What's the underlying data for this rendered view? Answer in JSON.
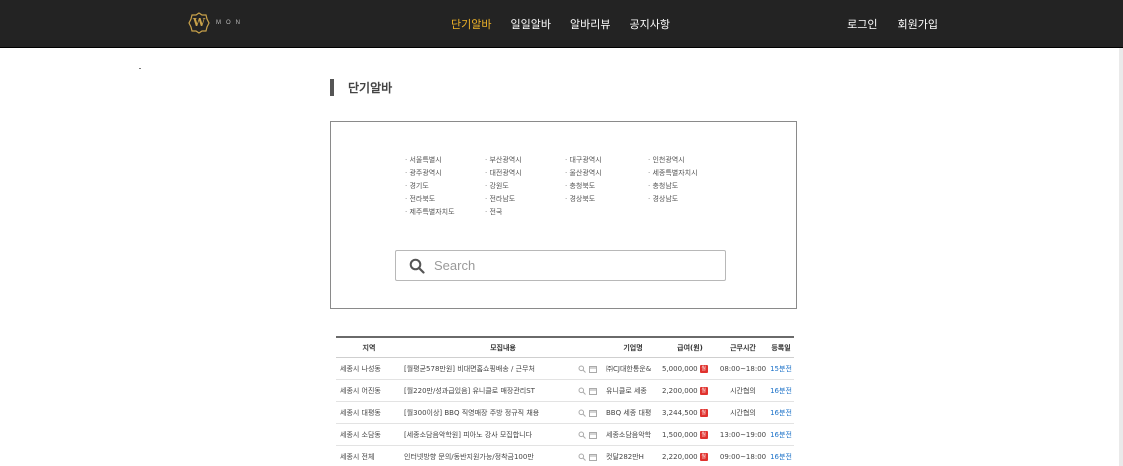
{
  "header": {
    "logo_letter": "W",
    "logo_text": "MON",
    "nav": [
      {
        "label": "단기알바"
      },
      {
        "label": "일일알바"
      },
      {
        "label": "알바리뷰"
      },
      {
        "label": "공지사항"
      }
    ],
    "auth": {
      "login": "로그인",
      "signup": "회원가입"
    }
  },
  "page": {
    "title": "단기알바"
  },
  "regions": [
    "서울특별시",
    "부산광역시",
    "대구광역시",
    "인천광역시",
    "광주광역시",
    "대전광역시",
    "울산광역시",
    "세종특별자치시",
    "경기도",
    "강원도",
    "충청북도",
    "충청남도",
    "전라북도",
    "전라남도",
    "경상북도",
    "경상남도",
    "제주특별자치도",
    "전국"
  ],
  "search": {
    "placeholder": "Search"
  },
  "table": {
    "headers": {
      "region": "지역",
      "content": "모집내용",
      "company": "기업명",
      "pay": "급여(원)",
      "hours": "근무시간",
      "posted": "등록일"
    },
    "rows": [
      {
        "region": "세종시 나성동",
        "content": "[월평균578만원] 비대면홈쇼핑배송 / 근무처",
        "company": "㈜CJ대한통운&",
        "pay": "5,000,000",
        "pay_unit": "월",
        "hours": "08:00~18:00",
        "posted": "15분전"
      },
      {
        "region": "세종시 어진동",
        "content": "[월220만/성과급있음] 유니클로 매장관리ST",
        "company": "유니클로 세종",
        "pay": "2,200,000",
        "pay_unit": "월",
        "hours": "시간협의",
        "posted": "16분전"
      },
      {
        "region": "세종시 대평동",
        "content": "[월300이상] BBQ 직영매장 주방 정규직 채용",
        "company": "BBQ 세종 대평",
        "pay": "3,244,500",
        "pay_unit": "월",
        "hours": "시간협의",
        "posted": "16분전"
      },
      {
        "region": "세종시 소담동",
        "content": "[세종소담음악학원] 피아노 강사 모집합니다",
        "company": "세종소담음악학",
        "pay": "1,500,000",
        "pay_unit": "월",
        "hours": "13:00~19:00",
        "posted": "16분전"
      },
      {
        "region": "세종시 전체",
        "content": "인터넷방향 문의/동반지원가능/정착금100만",
        "company": "컷달282만H",
        "pay": "2,220,000",
        "pay_unit": "월",
        "hours": "09:00~18:00",
        "posted": "16분전"
      }
    ]
  },
  "colors": {
    "topbar": "#232323",
    "active_nav": "#f0b429",
    "badge": "#e0322e",
    "link": "#1e73c9"
  },
  "icons": [
    "search-icon",
    "magnifier-icon",
    "calendar-icon"
  ]
}
